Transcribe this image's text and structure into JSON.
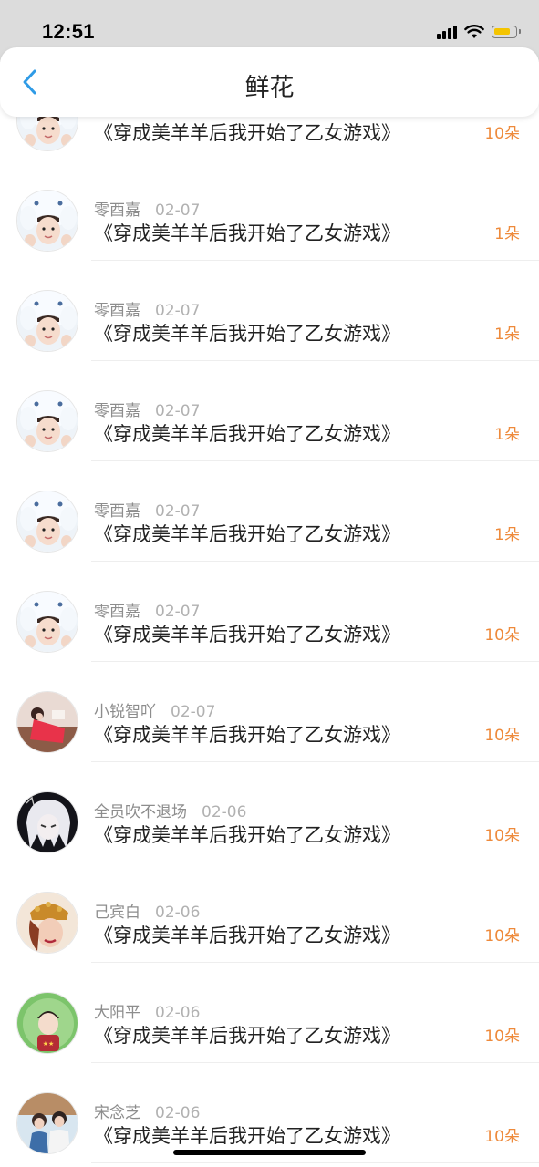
{
  "status_bar": {
    "time": "12:51"
  },
  "nav": {
    "title": "鲜花"
  },
  "list_items": [
    {
      "user": "",
      "date": "",
      "book": "《穿成美羊羊后我开始了乙女游戏》",
      "quantity": "10朵",
      "avatar": "cinnamoroll-hat-girl"
    },
    {
      "user": "零酉嘉",
      "date": "02-07",
      "book": "《穿成美羊羊后我开始了乙女游戏》",
      "quantity": "1朵",
      "avatar": "cinnamoroll-hat-girl"
    },
    {
      "user": "零酉嘉",
      "date": "02-07",
      "book": "《穿成美羊羊后我开始了乙女游戏》",
      "quantity": "1朵",
      "avatar": "cinnamoroll-hat-girl"
    },
    {
      "user": "零酉嘉",
      "date": "02-07",
      "book": "《穿成美羊羊后我开始了乙女游戏》",
      "quantity": "1朵",
      "avatar": "cinnamoroll-hat-girl"
    },
    {
      "user": "零酉嘉",
      "date": "02-07",
      "book": "《穿成美羊羊后我开始了乙女游戏》",
      "quantity": "1朵",
      "avatar": "cinnamoroll-hat-girl"
    },
    {
      "user": "零酉嘉",
      "date": "02-07",
      "book": "《穿成美羊羊后我开始了乙女游戏》",
      "quantity": "10朵",
      "avatar": "cinnamoroll-hat-girl"
    },
    {
      "user": "小锐智吖",
      "date": "02-07",
      "book": "《穿成美羊羊后我开始了乙女游戏》",
      "quantity": "10朵",
      "avatar": "red-dress-photo"
    },
    {
      "user": "全员吹不退场",
      "date": "02-06",
      "book": "《穿成美羊羊后我开始了乙女游戏》",
      "quantity": "10朵",
      "avatar": "white-hair-anime"
    },
    {
      "user": "己宾白",
      "date": "02-06",
      "book": "《穿成美羊羊后我开始了乙女游戏》",
      "quantity": "10朵",
      "avatar": "golden-crown-art"
    },
    {
      "user": "大阳平",
      "date": "02-06",
      "book": "《穿成美羊羊后我开始了乙女游戏》",
      "quantity": "10朵",
      "avatar": "green-circle-boy"
    },
    {
      "user": "宋念芝",
      "date": "02-06",
      "book": "《穿成美羊羊后我开始了乙女游戏》",
      "quantity": "10朵",
      "avatar": "couple-photo"
    }
  ],
  "colors": {
    "accent_blue": "#2f9be6",
    "quantity_orange": "#ee8a3b",
    "status_bar_bg": "#dcdcdc"
  }
}
